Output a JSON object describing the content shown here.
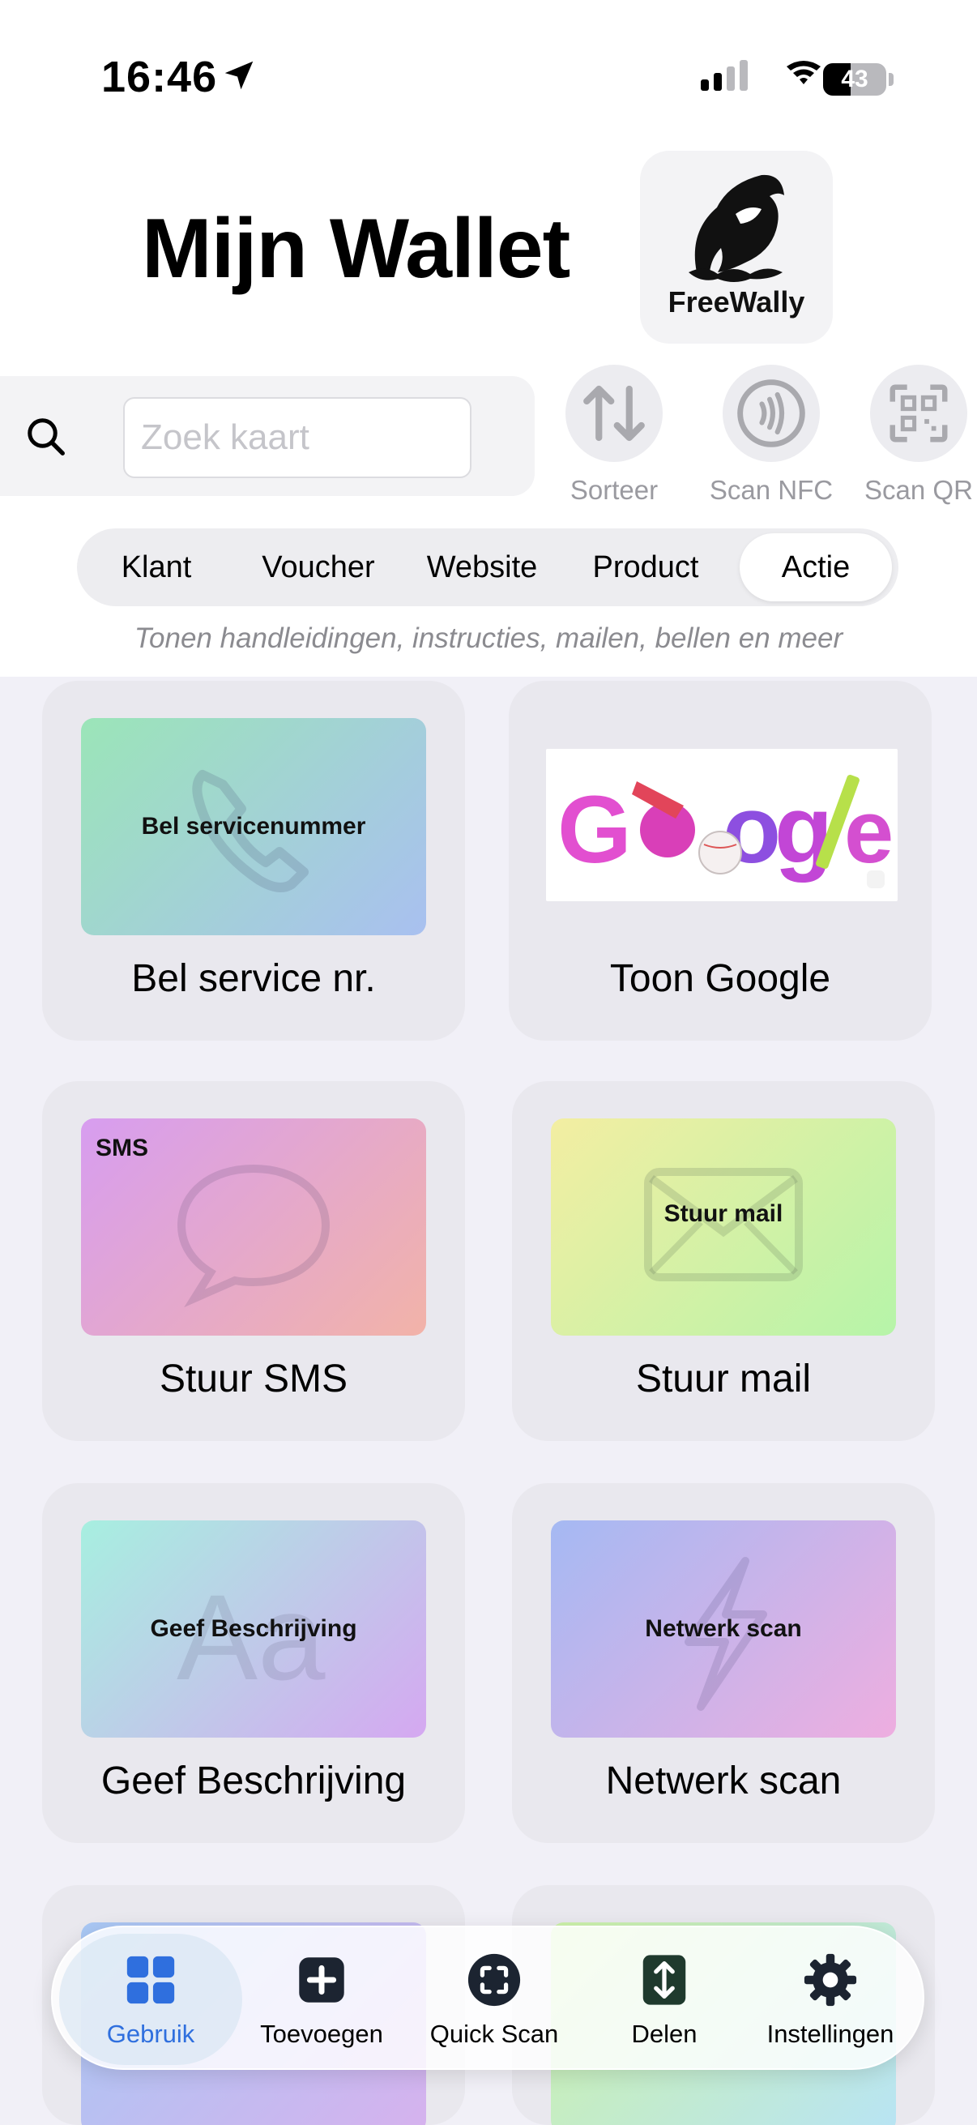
{
  "status_bar": {
    "time": "16:46",
    "battery": "43",
    "battery_level": 0.43
  },
  "header": {
    "title": "Mijn Wallet",
    "logo_text": "FreeWally"
  },
  "search": {
    "placeholder": "Zoek kaart",
    "value": ""
  },
  "tools": [
    {
      "label": "Sorteer",
      "icon": "sort-icon"
    },
    {
      "label": "Scan NFC",
      "icon": "nfc-icon"
    },
    {
      "label": "Scan QR",
      "icon": "qr-icon"
    }
  ],
  "segments": [
    "Klant",
    "Voucher",
    "Website",
    "Product",
    "Actie"
  ],
  "active_segment": "Actie",
  "hint": "Tonen handleidingen, instructies, mailen, bellen en meer",
  "cards": [
    {
      "title": "Bel service nr.",
      "thumb_label": "Bel servicenummer",
      "icon": "phone-icon",
      "colors": [
        "#9be5b8",
        "#a9c0f0"
      ]
    },
    {
      "title": "Toon Google",
      "thumb_label": "",
      "icon": "google-doodle-icon",
      "colors": [
        "#ffffff",
        "#ffffff"
      ]
    },
    {
      "title": "Stuur SMS",
      "thumb_label": "SMS",
      "icon": "chat-bubble-icon",
      "colors": [
        "#d79df0",
        "#f2b3a8"
      ]
    },
    {
      "title": "Stuur mail",
      "thumb_label": "Stuur mail",
      "icon": "envelope-icon",
      "colors": [
        "#f3eea2",
        "#b6f4a9"
      ]
    },
    {
      "title": "Geef Beschrijving",
      "thumb_label": "Geef Beschrijving",
      "icon": "text-aa-icon",
      "colors": [
        "#a7efe0",
        "#d5a8f1"
      ]
    },
    {
      "title": "Netwerk scan",
      "thumb_label": "Netwerk scan",
      "icon": "bolt-icon",
      "colors": [
        "#a5b9f3",
        "#eeaee0"
      ]
    }
  ],
  "tabbar": {
    "active": "Gebruik",
    "items": [
      {
        "label": "Gebruik",
        "icon": "grid-icon"
      },
      {
        "label": "Toevoegen",
        "icon": "plus-square-icon"
      },
      {
        "label": "Quick Scan",
        "icon": "scan-circle-icon"
      },
      {
        "label": "Delen",
        "icon": "share-arrows-icon"
      },
      {
        "label": "Instellingen",
        "icon": "gear-icon"
      }
    ]
  },
  "colors": {
    "accent": "#2f6fde",
    "card_bg": "#e9e8ee",
    "page_bg": "#f1f0f7"
  }
}
